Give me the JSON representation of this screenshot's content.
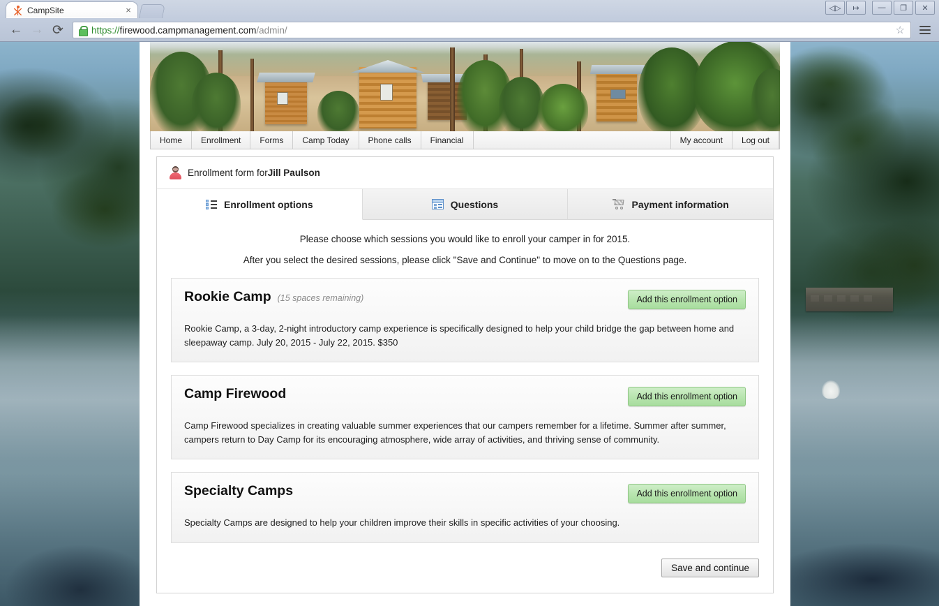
{
  "browser": {
    "tab": {
      "title": "CampSite",
      "favicon": "campsite-person-icon",
      "close_label": "×"
    },
    "newtab_label": "",
    "window_controls": [
      {
        "name": "split-view-button",
        "glyph": "◁▷"
      },
      {
        "name": "restore-session-button",
        "glyph": "↦"
      },
      {
        "name": "minimize-button",
        "glyph": "—"
      },
      {
        "name": "maximize-button",
        "glyph": "❐"
      },
      {
        "name": "close-button",
        "glyph": "✕"
      }
    ],
    "toolbar": {
      "back": "←",
      "forward": "→",
      "reload": "⟳",
      "bookmark_star": "☆",
      "menu": "menu-icon"
    },
    "url": {
      "scheme": "https://",
      "host": "firewood.campmanagement.com",
      "path": "/admin/",
      "secure_icon": "lock-icon"
    }
  },
  "site_nav": {
    "left_items": [
      "Home",
      "Enrollment",
      "Forms",
      "Camp Today",
      "Phone calls",
      "Financial"
    ],
    "right_items": [
      "My account",
      "Log out"
    ]
  },
  "panel": {
    "header_prefix": "Enrollment form for ",
    "header_name": "Jill Paulson",
    "tabs": [
      {
        "label": "Enrollment options",
        "icon": "list-icon",
        "active": true
      },
      {
        "label": "Questions",
        "icon": "form-icon",
        "active": false
      },
      {
        "label": "Payment information",
        "icon": "shopping-cart-icon",
        "active": false
      }
    ],
    "intro_line1": "Please choose which sessions you would like to enroll your camper in for 2015.",
    "intro_line2": "After you select the desired sessions, please click \"Save and Continue\" to move on to the Questions page.",
    "options": [
      {
        "title": "Rookie Camp",
        "spaces": "(15 spaces remaining)",
        "button": "Add this enrollment option",
        "description": "Rookie Camp, a 3-day, 2-night introductory camp experience is specifically designed to help your child bridge the gap between home and sleepaway camp. July 20, 2015 - July 22, 2015. $350"
      },
      {
        "title": "Camp Firewood",
        "spaces": "",
        "button": "Add this enrollment option",
        "description": "Camp Firewood specializes in creating valuable summer experiences that our campers remember for a lifetime. Summer after summer, campers return to Day Camp for its encouraging atmosphere, wide array of activities, and thriving sense of community."
      },
      {
        "title": "Specialty Camps",
        "spaces": "",
        "button": "Add this enrollment option",
        "description": "Specialty Camps are designed to help your children improve their skills in specific activities of your choosing."
      }
    ],
    "save_button": "Save and continue"
  },
  "colors": {
    "add_button_green": "#b9e5b0",
    "secure_green": "#2f8c2f",
    "active_tab_bg": "#ffffff",
    "panel_border": "#d2d2d2"
  }
}
